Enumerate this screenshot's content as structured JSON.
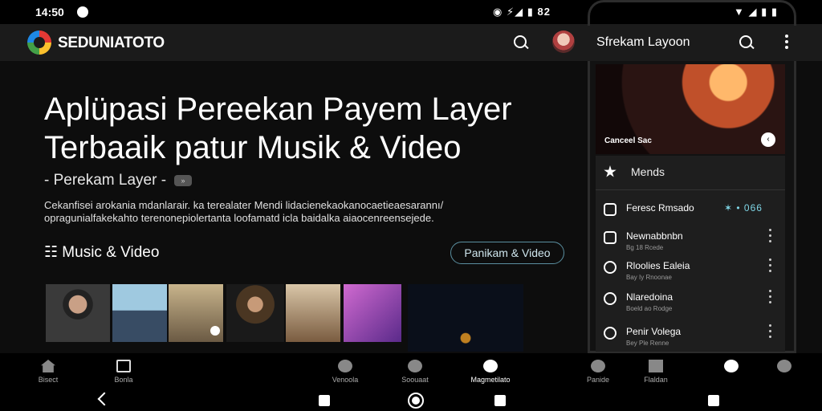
{
  "status_bar": {
    "time": "14:50",
    "icons_left": "◉ ⚡◢ ▮ 82",
    "icons_right": "▼ ◢ ▮ ▮"
  },
  "app_header": {
    "brand": "SEDUNIATOTO"
  },
  "phone_header": {
    "title": "Sfrekam Layoon"
  },
  "hero": {
    "title": "Aplüpasi Pereekan Payem Layer Terbaaik patur Musik & Video",
    "subtitle": "- Perekam Layer -",
    "subtitle_badge": "»",
    "description": "Cekanfisei arokania mdanlarair. ka terealater Mendi lidacienekaokanocaetieaesarannı/ opragunialfakekahto terenonepiolertanta loofamatd icla baidalka aiaocenreensejede."
  },
  "section": {
    "title": "☷ Music & Video",
    "button_label": "Panikam & Video"
  },
  "phone": {
    "concert_caption": "Canceel Sac",
    "concert_button": "‹",
    "list_header": "Mends",
    "items": [
      {
        "title": "Feresc Rmsado",
        "sub": "",
        "value": "✶ • 066"
      },
      {
        "title": "Newnabbnbn",
        "sub": "Bg 18 Rcede"
      },
      {
        "title": "Rloolies Ealeia",
        "sub": "Bay Iy Rnoonae"
      },
      {
        "title": "Nlaredoina",
        "sub": "Boeld ao Rodge"
      },
      {
        "title": "Penir Volega",
        "sub": "Bey Ple Renne"
      }
    ]
  },
  "bottom_nav": {
    "items": [
      {
        "label": "Bisect"
      },
      {
        "label": "Bonla"
      },
      {
        "label": "Venoola"
      },
      {
        "label": "Soouaat"
      },
      {
        "label": "Magmetilato"
      },
      {
        "label": "Panide"
      },
      {
        "label": "Flaldan"
      },
      {
        "label": ""
      },
      {
        "label": ""
      }
    ]
  },
  "colors": {
    "accent": "#7fd6e6",
    "pill_border": "#5a8fa0",
    "background": "#0d0d0d"
  }
}
